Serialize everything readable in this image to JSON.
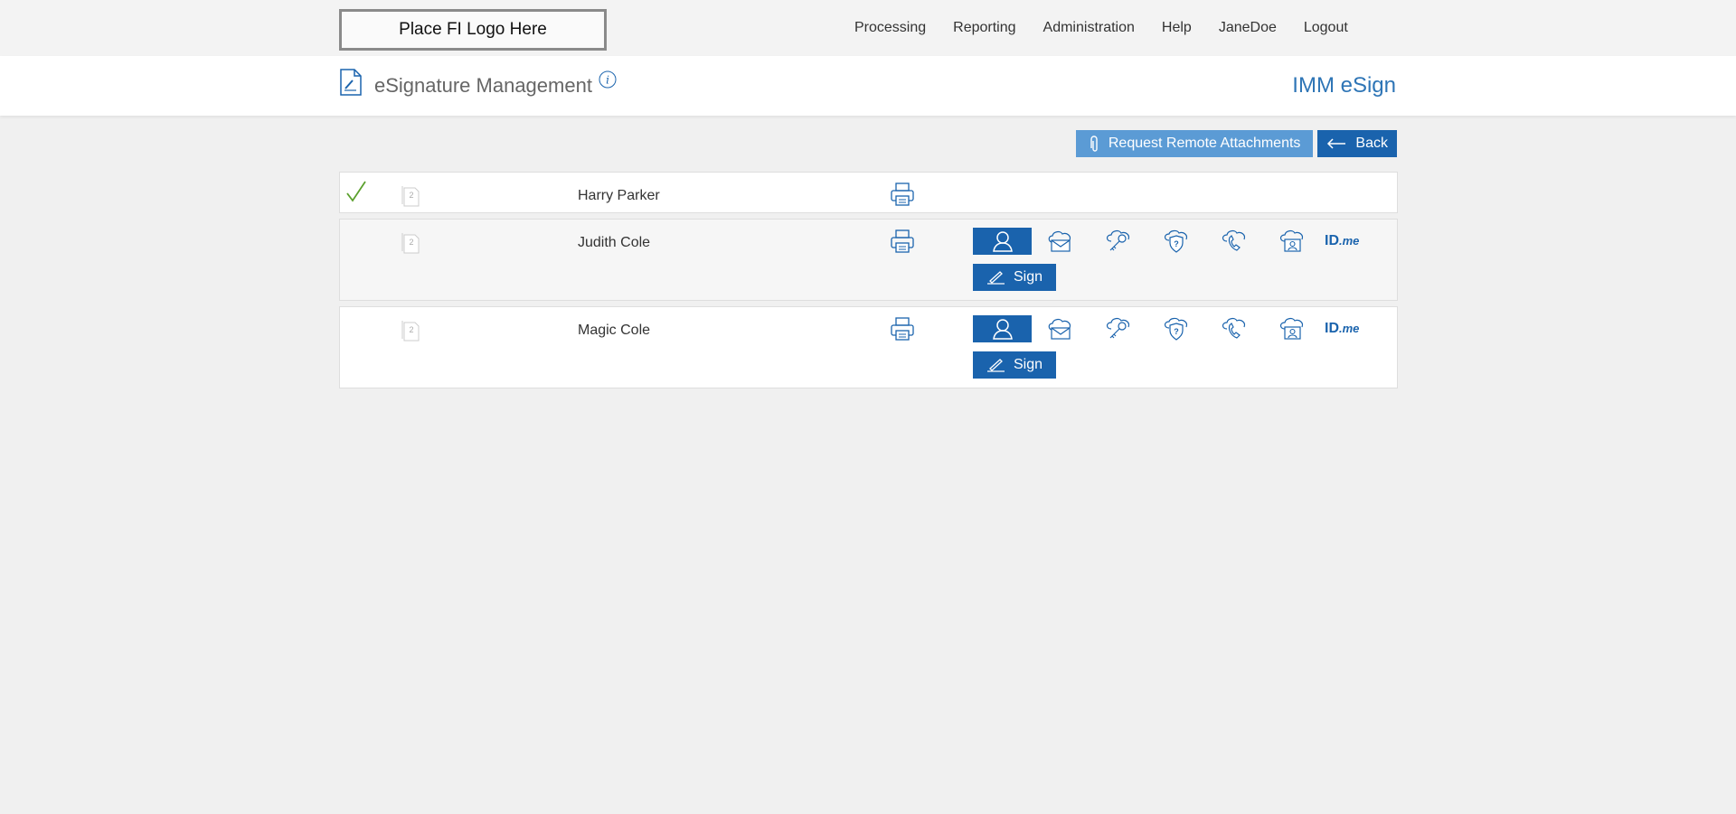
{
  "header": {
    "logo_text": "Place FI Logo Here",
    "nav": [
      "Processing",
      "Reporting",
      "Administration",
      "Help",
      "JaneDoe",
      "Logout"
    ]
  },
  "titlebar": {
    "title": "eSignature Management",
    "app_name": "IMM eSign"
  },
  "actions": {
    "attach_label": "Request Remote Attachments",
    "back_label": "Back"
  },
  "signers": [
    {
      "name": "Harry Parker",
      "doc_count": "2",
      "signed": true
    },
    {
      "name": "Judith Cole",
      "doc_count": "2",
      "signed": false
    },
    {
      "name": "Magic Cole",
      "doc_count": "2",
      "signed": false
    }
  ],
  "auth_methods": [
    "person-icon",
    "email-cloud-icon",
    "key-cloud-icon",
    "question-shield-icon",
    "phone-cloud-icon",
    "id-card-cloud-icon"
  ],
  "idme_label": {
    "id": "ID",
    "me": ".me"
  },
  "sign_label": "Sign",
  "colors": {
    "primary": "#1a63ad",
    "attach": "#5b9bd5",
    "app_name": "#2e75b6",
    "check": "#5aa02c"
  }
}
